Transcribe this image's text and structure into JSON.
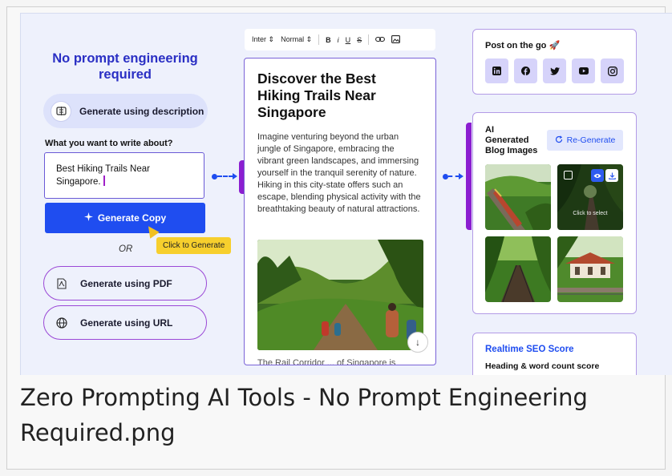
{
  "caption": "Zero Prompting AI Tools - No Prompt Engineering Required.png",
  "left": {
    "headline": "No prompt engineering required",
    "desc_pill": "Generate using description",
    "field_label": "What you want to write about?",
    "topic_value": "Best Hiking Trails Near Singapore.",
    "generate_button": "Generate Copy",
    "tooltip": "Click to Generate",
    "or": "OR",
    "pdf_pill": "Generate using PDF",
    "url_pill": "Generate using URL"
  },
  "toolbar": {
    "font": "Inter",
    "style": "Normal",
    "bold": "B",
    "italic": "i",
    "underline": "U",
    "strike": "S"
  },
  "editor": {
    "title": "Discover the Best Hiking Trails Near Singapore",
    "body": "Imagine venturing beyond the urban jungle of Singapore, embracing the vibrant green landscapes, and immersing yourself in the tranquil serenity of nature. Hiking in this city-state offers such an escape, blending physical activity with the breathtaking beauty of natural attractions.",
    "footer": "The Rail Corridor ... of Singapore is"
  },
  "social": {
    "title": "Post on the go 🚀",
    "icons": [
      "linkedin-icon",
      "facebook-icon",
      "twitter-icon",
      "youtube-icon",
      "instagram-icon"
    ]
  },
  "images_card": {
    "title_line1": "AI",
    "title_line2": "Generated",
    "title_line3": "Blog Images",
    "regenerate": "Re-Generate",
    "click_to_select": "Click to select"
  },
  "seo": {
    "title": "Realtime SEO Score",
    "subtitle": "Heading & word count score"
  },
  "colors": {
    "primary": "#1f4df0",
    "accent_purple": "#8b1ed0",
    "headline": "#2a2fc4",
    "tooltip": "#f7cf2d",
    "background": "#eef1fc"
  }
}
